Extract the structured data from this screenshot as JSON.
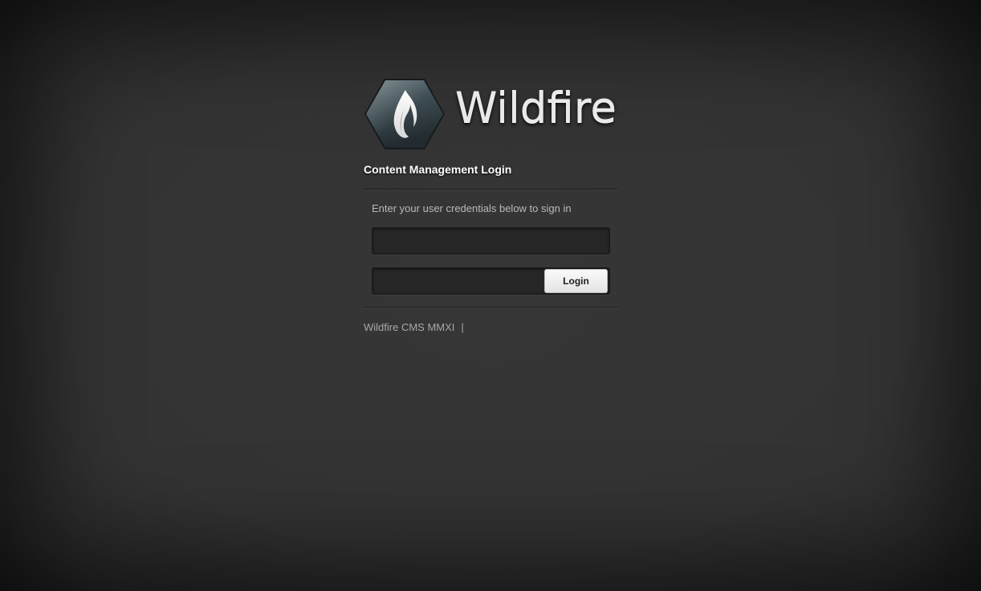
{
  "brand": {
    "name": "Wildfire",
    "logo_icon": "flame-hexagon-icon",
    "colors": {
      "hexagon": "#3a4a50",
      "flame": "#ffffff"
    }
  },
  "login": {
    "heading": "Content Management Login",
    "instructions": "Enter your user credentials below to sign in",
    "username": {
      "value": "",
      "placeholder": ""
    },
    "password": {
      "value": "",
      "placeholder": ""
    },
    "submit_label": "Login"
  },
  "footer": {
    "text": "Wildfire CMS MMXI",
    "separator": "|"
  }
}
